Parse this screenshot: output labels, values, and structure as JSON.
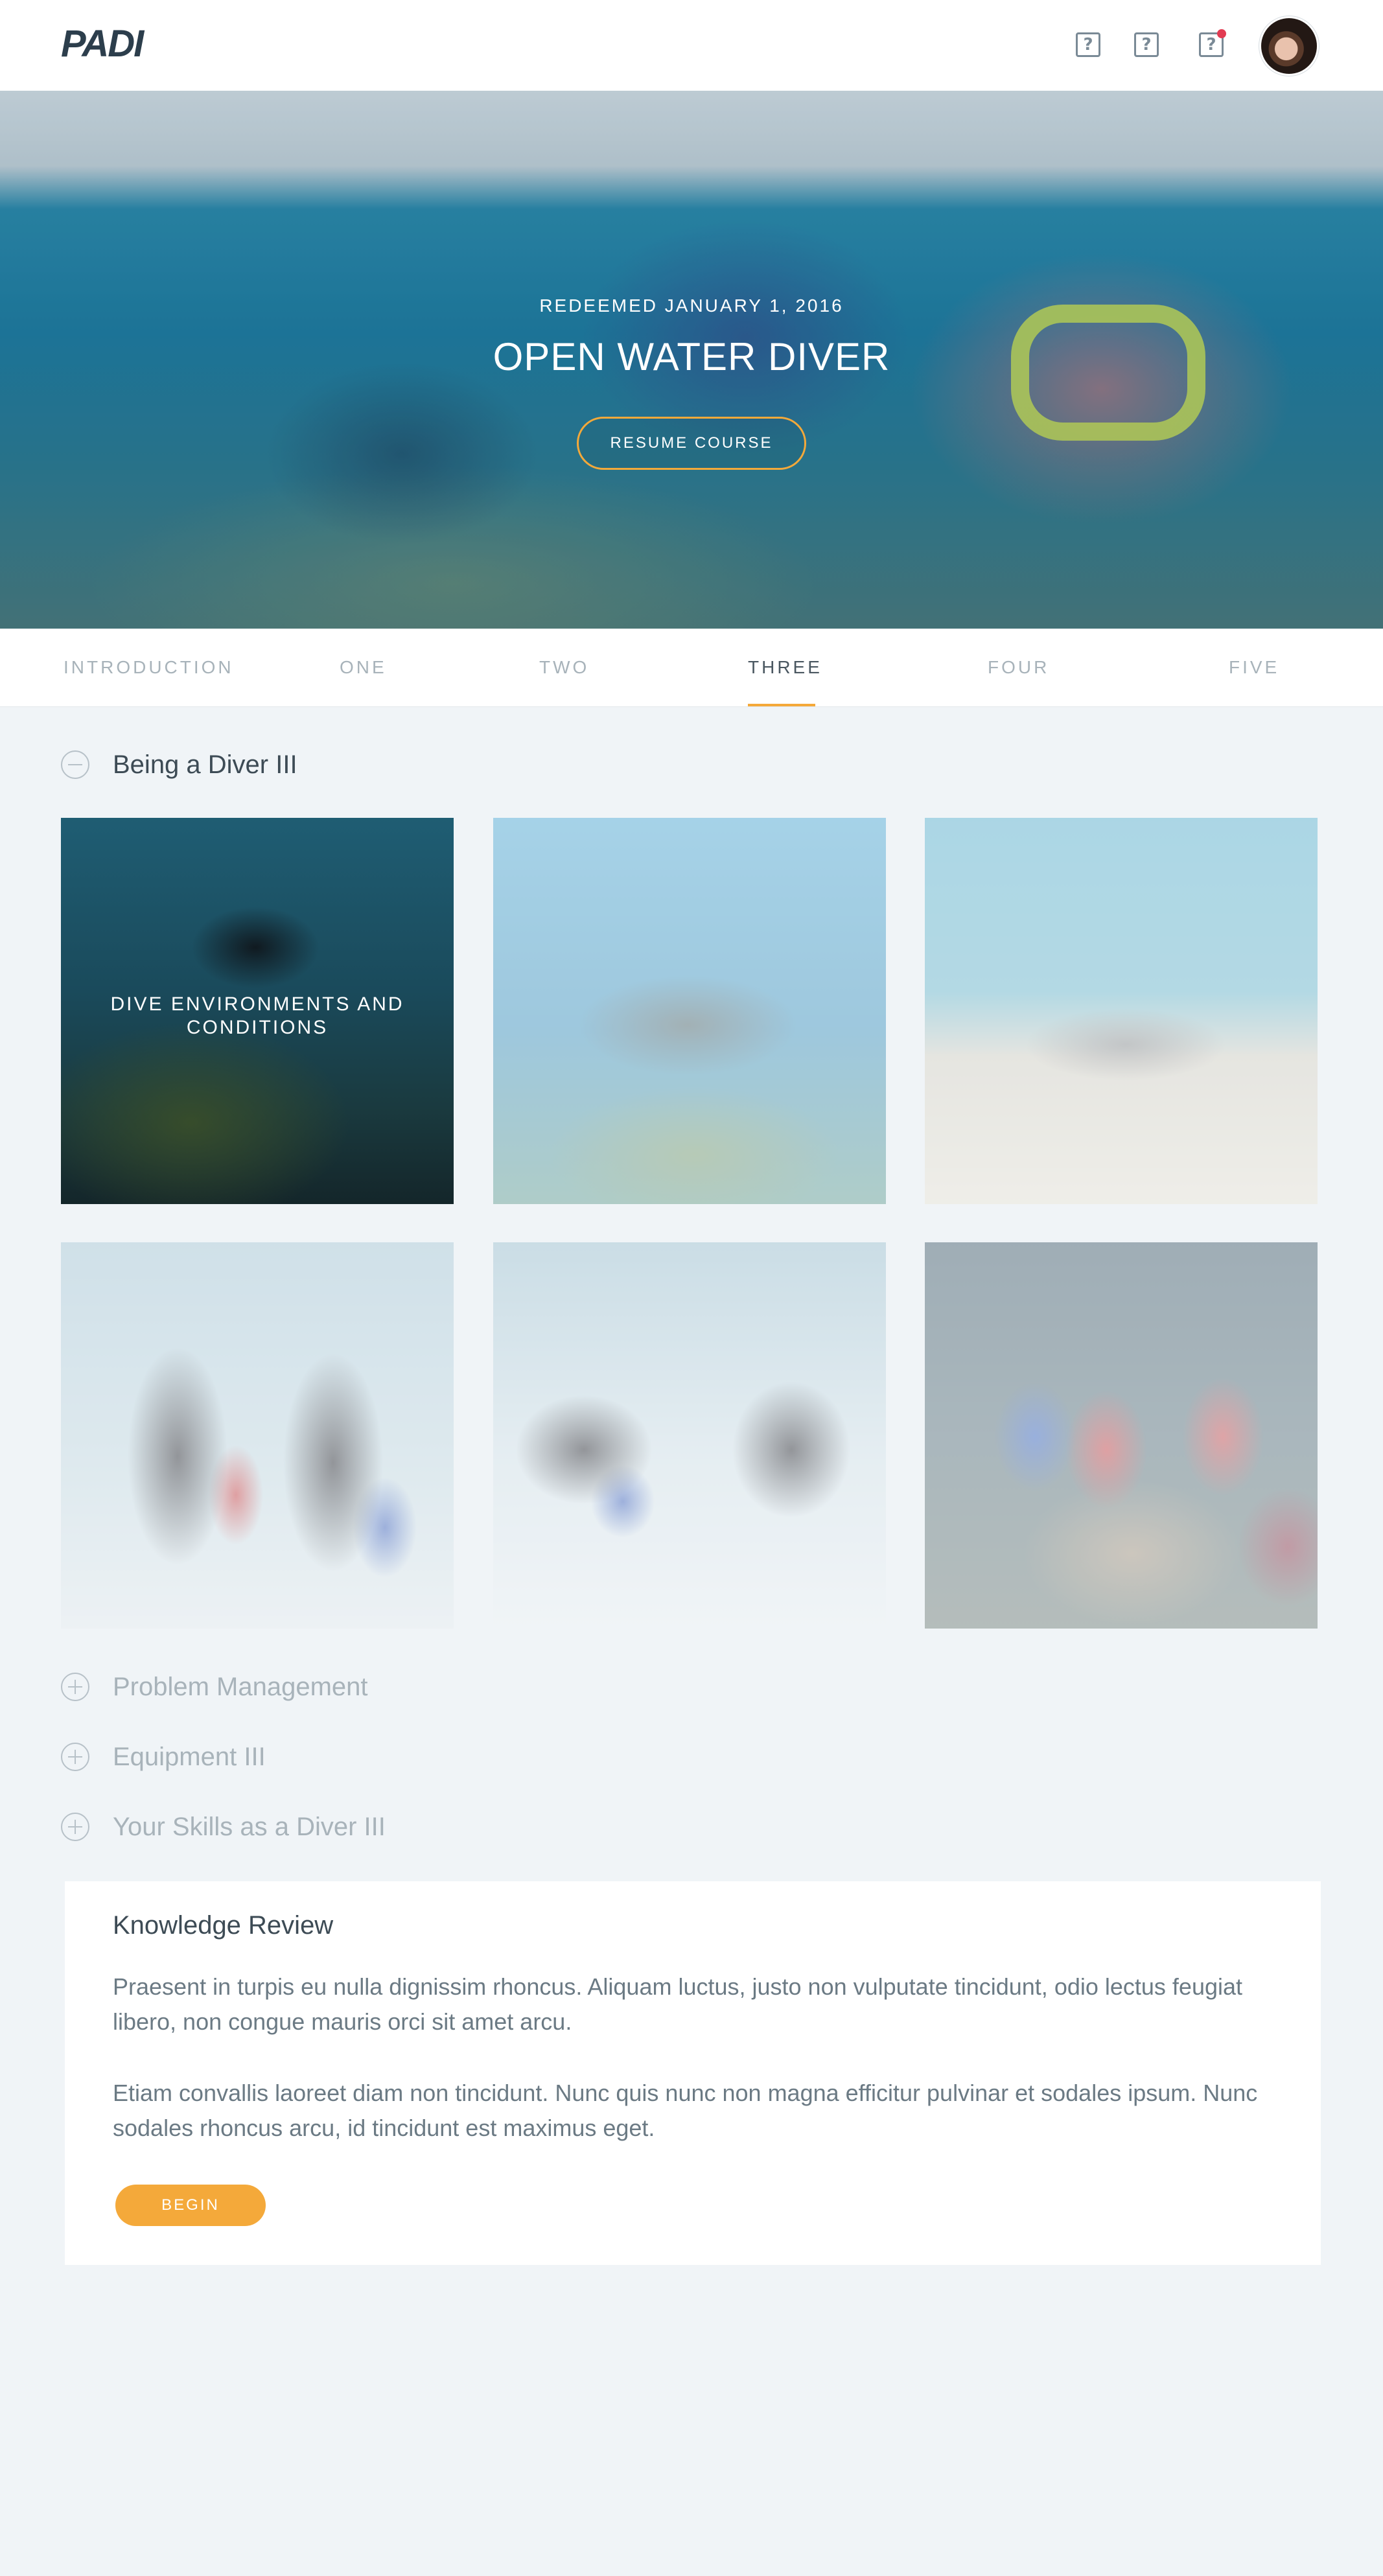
{
  "header": {
    "logo_text": "PADI",
    "icons": [
      {
        "name": "help-icon",
        "glyph": "?"
      },
      {
        "name": "help-icon",
        "glyph": "?"
      },
      {
        "name": "notification-icon",
        "glyph": "?",
        "has_notification": true
      }
    ],
    "notification_color": "#e23b52"
  },
  "hero": {
    "date": "REDEEMED JANUARY 1, 2016",
    "title": "OPEN WATER DIVER",
    "button": "RESUME COURSE",
    "accent": "#f4a93a"
  },
  "tabs": {
    "items": [
      "INTRODUCTION",
      "ONE",
      "TWO",
      "THREE",
      "FOUR",
      "FIVE"
    ],
    "active": "THREE"
  },
  "sections": {
    "open": "Being a Diver III",
    "tiles": [
      {
        "title": "DIVE ENVIRONMENTS AND CONDITIONS",
        "state": "highlighted"
      },
      {
        "title": "",
        "state": "faded"
      },
      {
        "title": "",
        "state": "faded"
      },
      {
        "title": "",
        "state": "faded"
      },
      {
        "title": "",
        "state": "faded"
      },
      {
        "title": "",
        "state": "faded"
      }
    ],
    "collapsed": [
      "Problem Management",
      "Equipment III",
      "Your Skills as a Diver III"
    ]
  },
  "review": {
    "title": "Knowledge Review",
    "paragraph1": "Praesent in turpis eu nulla dignissim rhoncus. Aliquam luctus, justo non vulputate tincidunt, odio lectus feugiat libero, non congue mauris orci sit amet arcu.",
    "paragraph2": "Etiam convallis laoreet diam non tincidunt. Nunc quis nunc non magna efficitur pulvinar et sodales ipsum. Nunc sodales rhoncus arcu, id tincidunt est maximus eget.",
    "button": "BEGIN"
  }
}
